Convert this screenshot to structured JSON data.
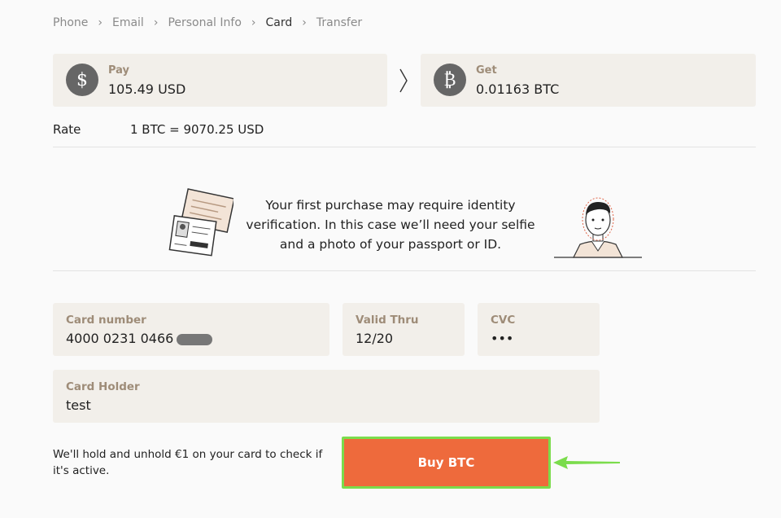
{
  "breadcrumb": [
    "Phone",
    "Email",
    "Personal Info",
    "Card",
    "Transfer"
  ],
  "breadcrumb_active": "Card",
  "pay": {
    "label": "Pay",
    "value": "105.49 USD",
    "icon": "dollar-icon",
    "glyph": "$"
  },
  "get": {
    "label": "Get",
    "value": "0.01163 BTC",
    "icon": "bitcoin-icon",
    "glyph": "₿"
  },
  "rate": {
    "label": "Rate",
    "value": "1 BTC = 9070.25 USD"
  },
  "notice": {
    "lines": [
      "Your first purchase may require identity",
      "verification. In this case we’ll need your selfie",
      "and a photo of your passport or ID."
    ]
  },
  "card_number": {
    "label": "Card number",
    "value": "4000 0231 0466"
  },
  "valid_thru": {
    "label": "Valid Thru",
    "value": "12/20"
  },
  "cvc": {
    "label": "CVC",
    "value": "•••"
  },
  "card_holder": {
    "label": "Card Holder",
    "value": "test"
  },
  "hold_note": "We'll hold and unhold €1 on your card to check if it's active.",
  "buy_button": "Buy BTC",
  "colors": {
    "accent": "#ee6a3c",
    "highlight": "#7bdc4c",
    "field_bg": "#f2efea",
    "label": "#9e8c78"
  }
}
